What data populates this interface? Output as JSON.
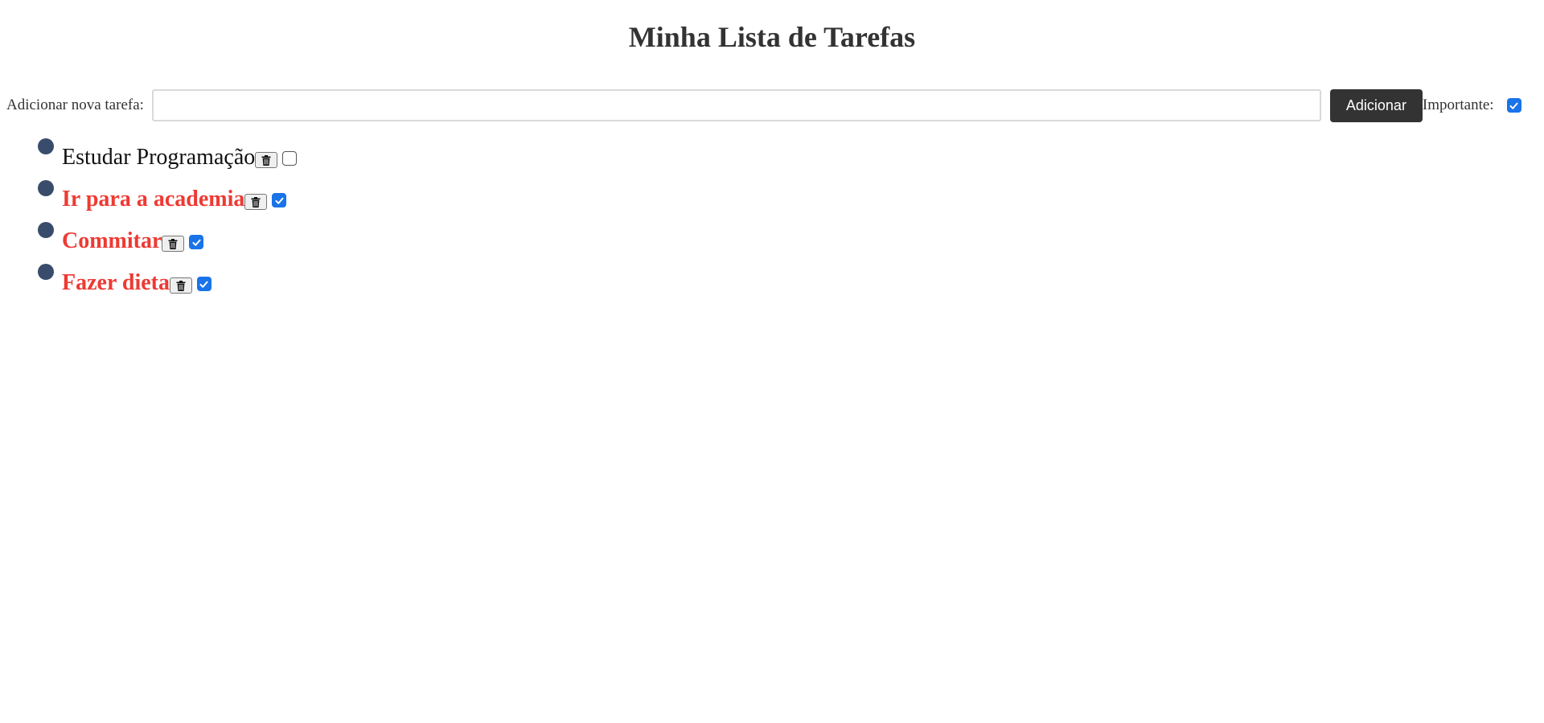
{
  "header": {
    "title": "Minha Lista de Tarefas"
  },
  "form": {
    "label": "Adicionar nova tarefa:",
    "input_value": "",
    "input_placeholder": "",
    "add_button_label": "Adicionar",
    "important_label": "Importante:",
    "important_checked": true
  },
  "tasks": [
    {
      "text": "Estudar Programação",
      "important": false,
      "checked": false,
      "delete_icon": "trash-icon"
    },
    {
      "text": "Ir para a academia",
      "important": true,
      "checked": true,
      "delete_icon": "trash-icon"
    },
    {
      "text": "Commitar",
      "important": true,
      "checked": true,
      "delete_icon": "trash-icon"
    },
    {
      "text": "Fazer dieta",
      "important": true,
      "checked": true,
      "delete_icon": "trash-icon"
    }
  ],
  "colors": {
    "important_text": "#ee3a33",
    "normal_text": "#111111",
    "bullet": "#3a4c6b",
    "checkbox_accent": "#1a73e8",
    "button_bg": "#333333"
  }
}
